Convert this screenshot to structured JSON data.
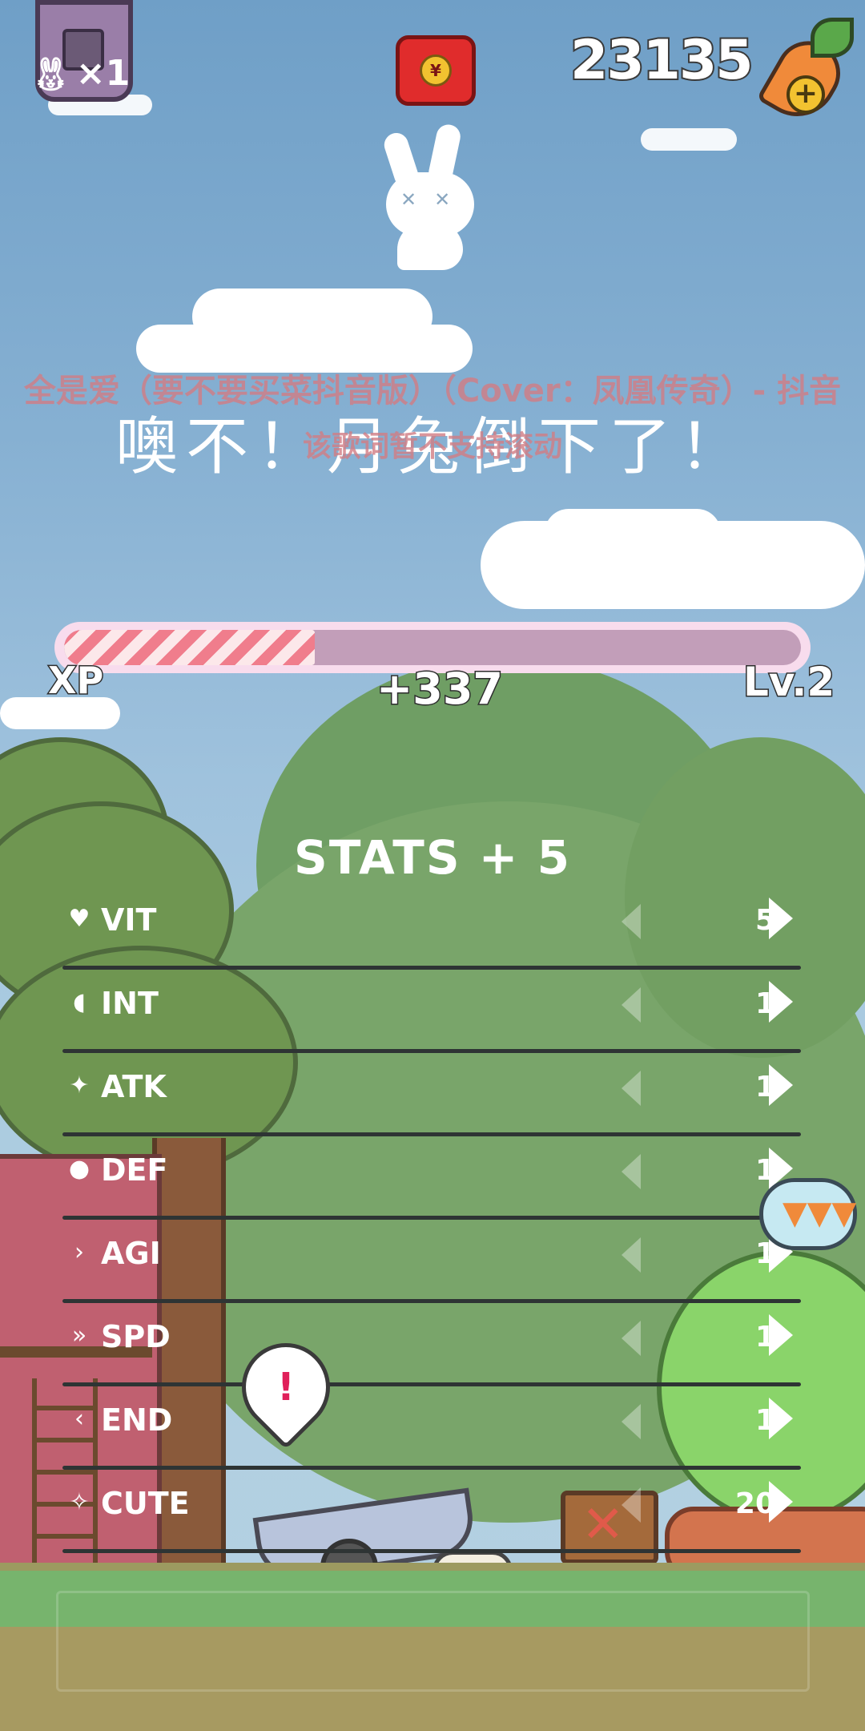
{
  "hud": {
    "lives": "×1",
    "coins": "23135",
    "red_packet_icon": "red-envelope-icon",
    "carrot_add_icon": "carrot-plus-icon"
  },
  "overlay": {
    "lyric_line1": "全是爱（要不要买菜抖音版）（Cover：凤凰传奇）- 抖音",
    "lyric_line2": "该歌词暂不支持滚动",
    "death_message": "噢不！月兔倒下了！"
  },
  "xp": {
    "label": "XP",
    "gain": "+337",
    "level": "Lv.2",
    "progress": 0.34
  },
  "stats": {
    "title": "STATS + 5",
    "rows": [
      {
        "icon": "♥",
        "name": "VIT",
        "value": "5"
      },
      {
        "icon": "◖",
        "name": "INT",
        "value": "1"
      },
      {
        "icon": "✦",
        "name": "ATK",
        "value": "1"
      },
      {
        "icon": "●",
        "name": "DEF",
        "value": "1"
      },
      {
        "icon": "›",
        "name": "AGI",
        "value": "1"
      },
      {
        "icon": "»",
        "name": "SPD",
        "value": "1"
      },
      {
        "icon": "‹",
        "name": "END",
        "value": "1"
      },
      {
        "icon": "✧",
        "name": "CUTE",
        "value": "20"
      }
    ]
  },
  "bubbles": {
    "alert": "!"
  },
  "colors": {
    "sky": "#86b0d2",
    "xp_fill": "#f07d8c",
    "xp_track": "#c29eb9",
    "foliage": "#6f9651"
  }
}
